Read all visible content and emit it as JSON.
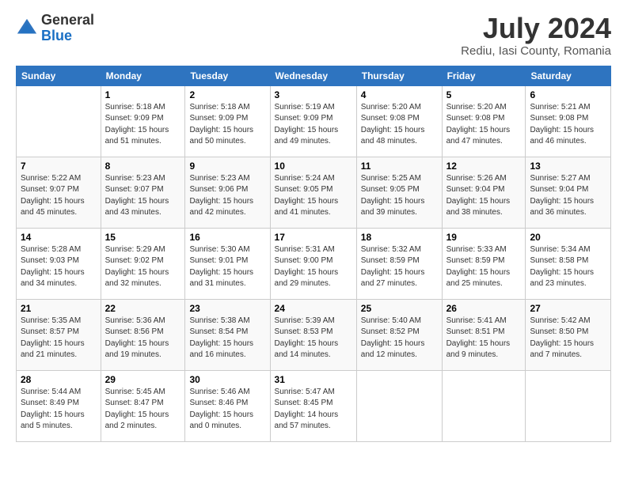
{
  "header": {
    "logo_general": "General",
    "logo_blue": "Blue",
    "month": "July 2024",
    "location": "Rediu, Iasi County, Romania"
  },
  "columns": [
    "Sunday",
    "Monday",
    "Tuesday",
    "Wednesday",
    "Thursday",
    "Friday",
    "Saturday"
  ],
  "weeks": [
    [
      {
        "day": "",
        "info": ""
      },
      {
        "day": "1",
        "info": "Sunrise: 5:18 AM\nSunset: 9:09 PM\nDaylight: 15 hours\nand 51 minutes."
      },
      {
        "day": "2",
        "info": "Sunrise: 5:18 AM\nSunset: 9:09 PM\nDaylight: 15 hours\nand 50 minutes."
      },
      {
        "day": "3",
        "info": "Sunrise: 5:19 AM\nSunset: 9:09 PM\nDaylight: 15 hours\nand 49 minutes."
      },
      {
        "day": "4",
        "info": "Sunrise: 5:20 AM\nSunset: 9:08 PM\nDaylight: 15 hours\nand 48 minutes."
      },
      {
        "day": "5",
        "info": "Sunrise: 5:20 AM\nSunset: 9:08 PM\nDaylight: 15 hours\nand 47 minutes."
      },
      {
        "day": "6",
        "info": "Sunrise: 5:21 AM\nSunset: 9:08 PM\nDaylight: 15 hours\nand 46 minutes."
      }
    ],
    [
      {
        "day": "7",
        "info": "Sunrise: 5:22 AM\nSunset: 9:07 PM\nDaylight: 15 hours\nand 45 minutes."
      },
      {
        "day": "8",
        "info": "Sunrise: 5:23 AM\nSunset: 9:07 PM\nDaylight: 15 hours\nand 43 minutes."
      },
      {
        "day": "9",
        "info": "Sunrise: 5:23 AM\nSunset: 9:06 PM\nDaylight: 15 hours\nand 42 minutes."
      },
      {
        "day": "10",
        "info": "Sunrise: 5:24 AM\nSunset: 9:05 PM\nDaylight: 15 hours\nand 41 minutes."
      },
      {
        "day": "11",
        "info": "Sunrise: 5:25 AM\nSunset: 9:05 PM\nDaylight: 15 hours\nand 39 minutes."
      },
      {
        "day": "12",
        "info": "Sunrise: 5:26 AM\nSunset: 9:04 PM\nDaylight: 15 hours\nand 38 minutes."
      },
      {
        "day": "13",
        "info": "Sunrise: 5:27 AM\nSunset: 9:04 PM\nDaylight: 15 hours\nand 36 minutes."
      }
    ],
    [
      {
        "day": "14",
        "info": "Sunrise: 5:28 AM\nSunset: 9:03 PM\nDaylight: 15 hours\nand 34 minutes."
      },
      {
        "day": "15",
        "info": "Sunrise: 5:29 AM\nSunset: 9:02 PM\nDaylight: 15 hours\nand 32 minutes."
      },
      {
        "day": "16",
        "info": "Sunrise: 5:30 AM\nSunset: 9:01 PM\nDaylight: 15 hours\nand 31 minutes."
      },
      {
        "day": "17",
        "info": "Sunrise: 5:31 AM\nSunset: 9:00 PM\nDaylight: 15 hours\nand 29 minutes."
      },
      {
        "day": "18",
        "info": "Sunrise: 5:32 AM\nSunset: 8:59 PM\nDaylight: 15 hours\nand 27 minutes."
      },
      {
        "day": "19",
        "info": "Sunrise: 5:33 AM\nSunset: 8:59 PM\nDaylight: 15 hours\nand 25 minutes."
      },
      {
        "day": "20",
        "info": "Sunrise: 5:34 AM\nSunset: 8:58 PM\nDaylight: 15 hours\nand 23 minutes."
      }
    ],
    [
      {
        "day": "21",
        "info": "Sunrise: 5:35 AM\nSunset: 8:57 PM\nDaylight: 15 hours\nand 21 minutes."
      },
      {
        "day": "22",
        "info": "Sunrise: 5:36 AM\nSunset: 8:56 PM\nDaylight: 15 hours\nand 19 minutes."
      },
      {
        "day": "23",
        "info": "Sunrise: 5:38 AM\nSunset: 8:54 PM\nDaylight: 15 hours\nand 16 minutes."
      },
      {
        "day": "24",
        "info": "Sunrise: 5:39 AM\nSunset: 8:53 PM\nDaylight: 15 hours\nand 14 minutes."
      },
      {
        "day": "25",
        "info": "Sunrise: 5:40 AM\nSunset: 8:52 PM\nDaylight: 15 hours\nand 12 minutes."
      },
      {
        "day": "26",
        "info": "Sunrise: 5:41 AM\nSunset: 8:51 PM\nDaylight: 15 hours\nand 9 minutes."
      },
      {
        "day": "27",
        "info": "Sunrise: 5:42 AM\nSunset: 8:50 PM\nDaylight: 15 hours\nand 7 minutes."
      }
    ],
    [
      {
        "day": "28",
        "info": "Sunrise: 5:44 AM\nSunset: 8:49 PM\nDaylight: 15 hours\nand 5 minutes."
      },
      {
        "day": "29",
        "info": "Sunrise: 5:45 AM\nSunset: 8:47 PM\nDaylight: 15 hours\nand 2 minutes."
      },
      {
        "day": "30",
        "info": "Sunrise: 5:46 AM\nSunset: 8:46 PM\nDaylight: 15 hours\nand 0 minutes."
      },
      {
        "day": "31",
        "info": "Sunrise: 5:47 AM\nSunset: 8:45 PM\nDaylight: 14 hours\nand 57 minutes."
      },
      {
        "day": "",
        "info": ""
      },
      {
        "day": "",
        "info": ""
      },
      {
        "day": "",
        "info": ""
      }
    ]
  ]
}
